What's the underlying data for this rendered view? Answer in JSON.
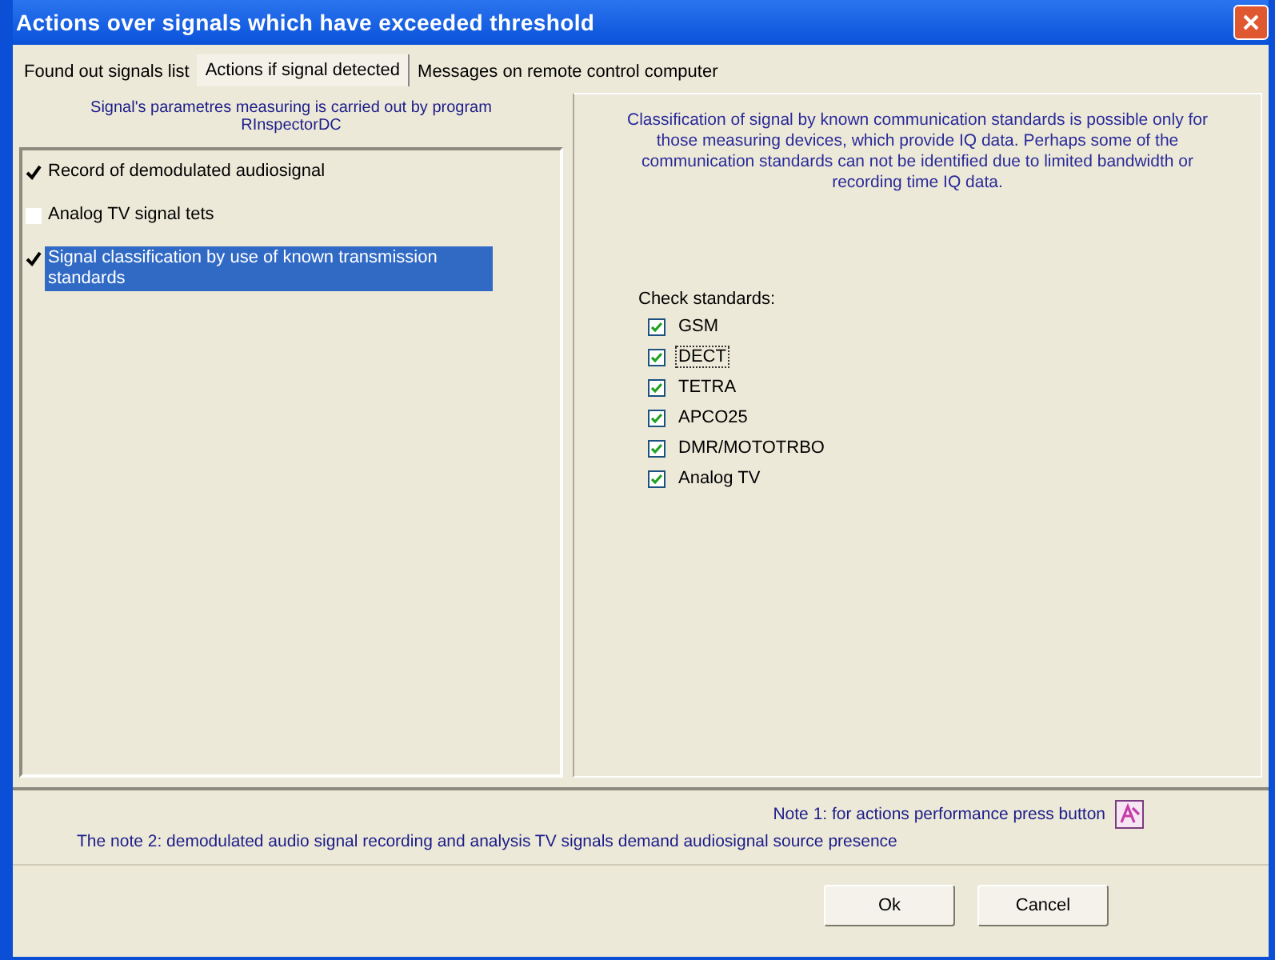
{
  "window": {
    "title": "Actions over signals which have exceeded threshold"
  },
  "tabs": [
    {
      "label": "Found out signals list",
      "selected": false
    },
    {
      "label": "Actions if signal detected",
      "selected": true
    },
    {
      "label": "Messages on remote control computer",
      "selected": false
    }
  ],
  "left_panel": {
    "header": "Signal's parametres measuring is carried out by program RInspectorDC",
    "actions": [
      {
        "label": "Record of demodulated audiosignal",
        "checked": true,
        "selected": false
      },
      {
        "label": "Analog TV signal tets",
        "checked": false,
        "selected": false
      },
      {
        "label": "Signal classification by use of known transmission standards",
        "checked": true,
        "selected": true
      }
    ]
  },
  "right_panel": {
    "info": "Classification of signal by known communication standards is possible only for those measuring devices, which provide IQ data. Perhaps some of the communication standards can not be identified due to limited bandwidth or recording time IQ data.",
    "standards_label": "Check standards:",
    "standards": [
      {
        "label": "GSM",
        "checked": true,
        "focused": false
      },
      {
        "label": "DECT",
        "checked": true,
        "focused": true
      },
      {
        "label": "TETRA",
        "checked": true,
        "focused": false
      },
      {
        "label": "APCO25",
        "checked": true,
        "focused": false
      },
      {
        "label": "DMR/MOTOTRBO",
        "checked": true,
        "focused": false
      },
      {
        "label": "Analog TV",
        "checked": true,
        "focused": false
      }
    ]
  },
  "notes": {
    "note_1": "Note 1: for actions performance press button",
    "note_2": "The note 2: demodulated audio signal recording and analysis TV signals demand audiosignal source presence"
  },
  "buttons": [
    "Ok",
    "Cancel"
  ]
}
